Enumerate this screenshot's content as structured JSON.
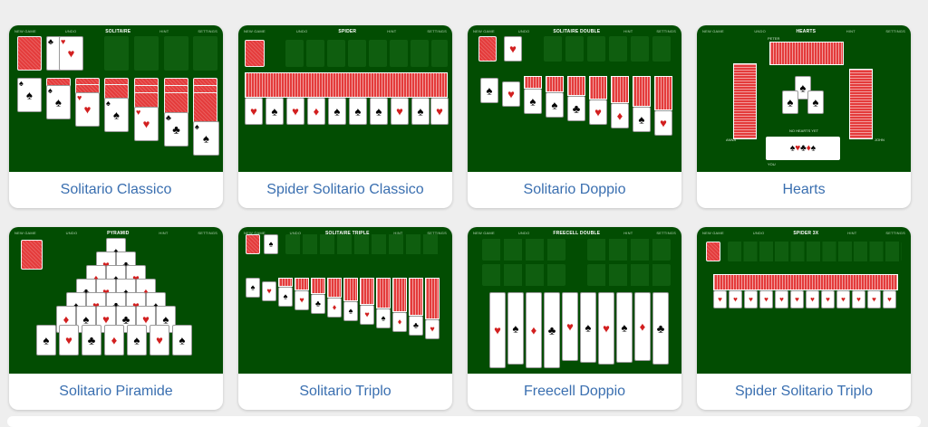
{
  "games": [
    {
      "title": "Solitario Classico",
      "header": "SOLITAIRE"
    },
    {
      "title": "Spider Solitario Classico",
      "header": "SPIDER"
    },
    {
      "title": "Solitario Doppio",
      "header": "SOLITAIRE DOUBLE"
    },
    {
      "title": "Hearts",
      "header": "HEARTS"
    },
    {
      "title": "Solitario Piramide",
      "header": "PYRAMID"
    },
    {
      "title": "Solitario Triplo",
      "header": "SOLITAIRE TRIPLE"
    },
    {
      "title": "Freecell Doppio",
      "header": "FREECELL DOUBLE"
    },
    {
      "title": "Spider Solitario Triplo",
      "header": "SPIDER 3X"
    }
  ],
  "thumb_menu": [
    "NEW GAME",
    "UNDO",
    "HINT",
    "SETTINGS"
  ],
  "hearts_labels": {
    "player_top": "PETER",
    "player_left": "ANNA",
    "player_right": "JOHN",
    "player_bottom": "YOU",
    "status": "NO HEARTS YET"
  },
  "colors": {
    "felt": "#024d02",
    "card_back": "#e43b3b",
    "link": "#3a6fb0",
    "page_bg": "#eeeeee"
  },
  "suits": {
    "spade": "♠",
    "heart": "♥",
    "club": "♣",
    "diamond": "♦"
  }
}
